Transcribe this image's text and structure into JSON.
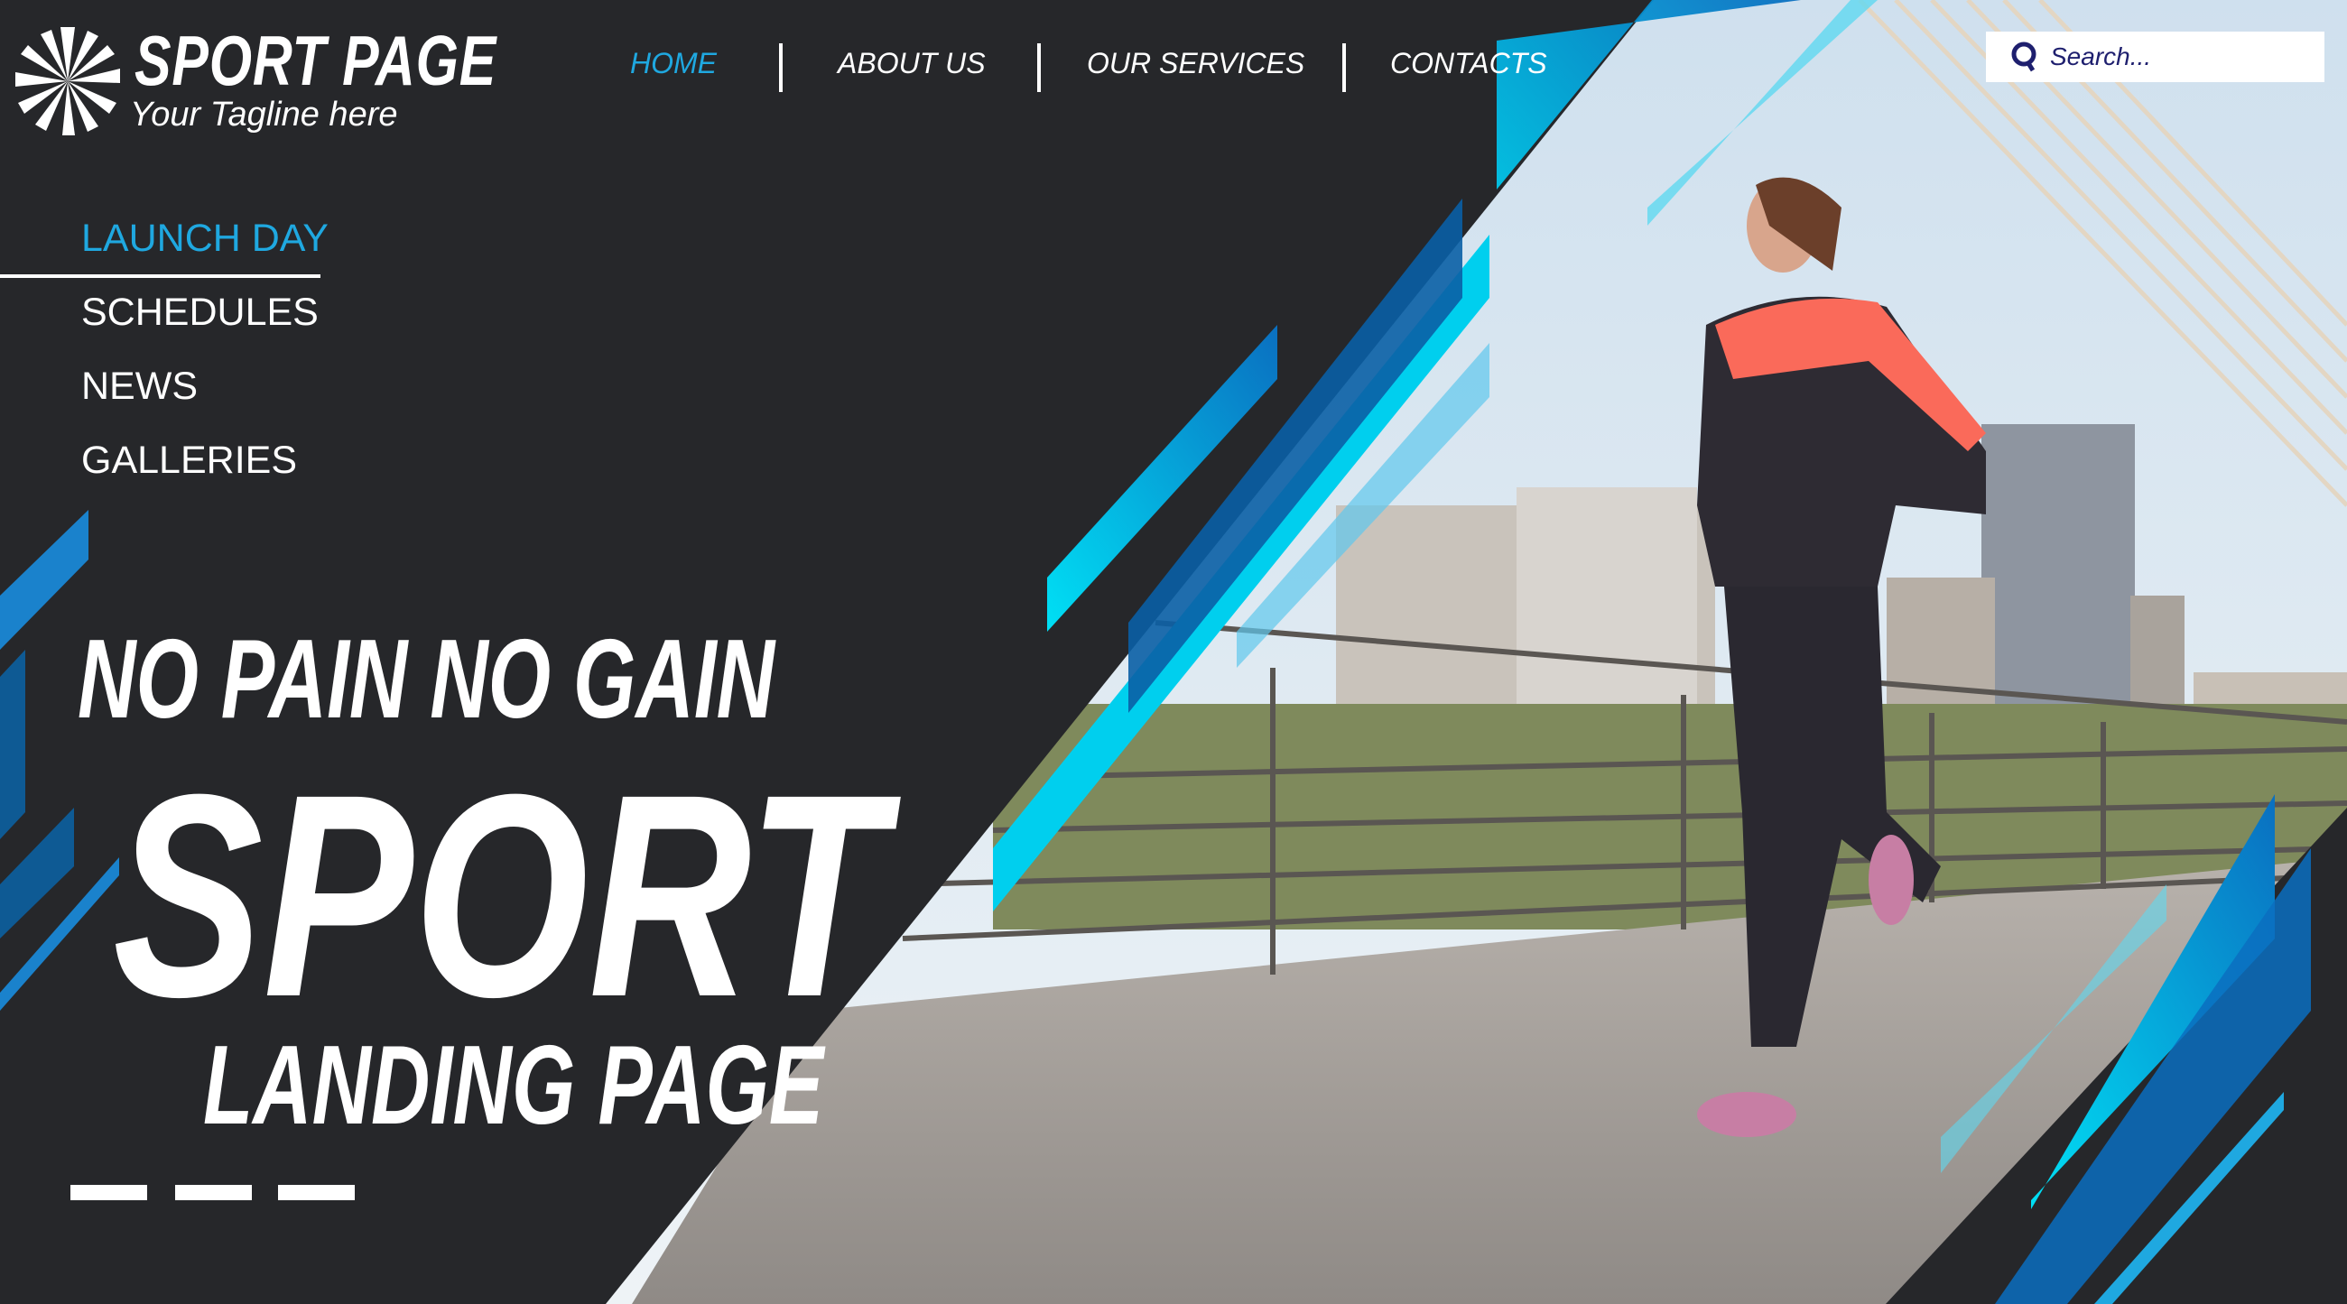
{
  "brand": {
    "title": "SPORT PAGE",
    "tagline": "Your Tagline here"
  },
  "nav": {
    "items": [
      {
        "label": "HOME",
        "active": true
      },
      {
        "label": "ABOUT US",
        "active": false
      },
      {
        "label": "OUR SERVICES",
        "active": false
      },
      {
        "label": "CONTACTS",
        "active": false
      }
    ]
  },
  "search": {
    "placeholder": "Search...",
    "icon": "search-icon"
  },
  "sidebar": {
    "items": [
      {
        "label": "LAUNCH DAY",
        "active": true
      },
      {
        "label": "SCHEDULES",
        "active": false
      },
      {
        "label": "NEWS",
        "active": false
      },
      {
        "label": "GALLERIES",
        "active": false
      }
    ]
  },
  "hero": {
    "line1": "NO PAIN NO GAIN",
    "line2": "SPORT",
    "line3": "LANDING PAGE"
  },
  "colors": {
    "background": "#26272a",
    "accent": "#1fa8e0",
    "cyan": "#00d4f0",
    "search_text": "#1e1f6e"
  }
}
